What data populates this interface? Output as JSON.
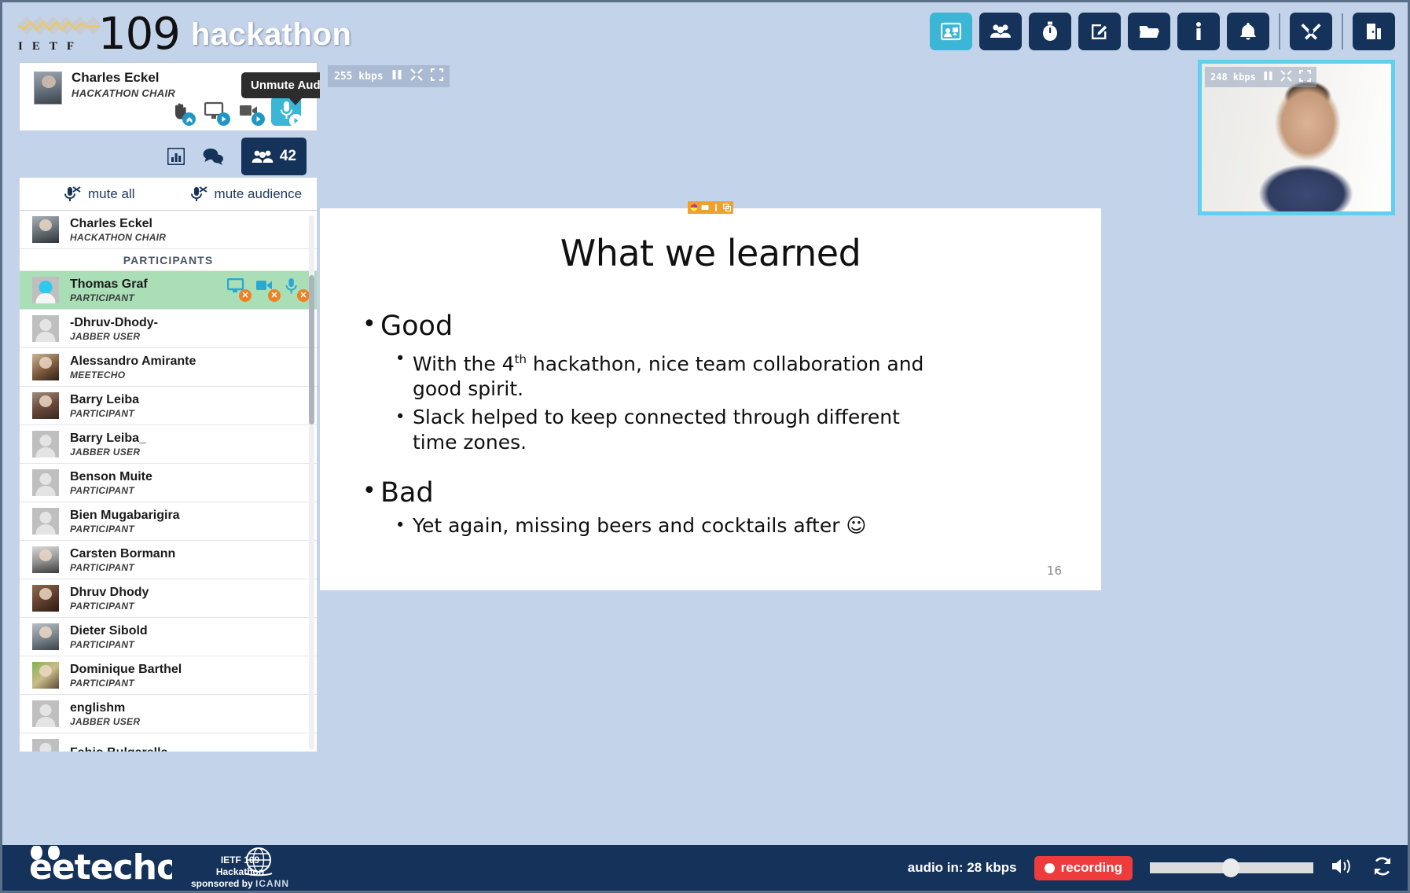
{
  "header": {
    "conference_number": "109",
    "conference_word": "hackathon",
    "ietf_letters": "IETF",
    "toolbar": [
      {
        "name": "presentation-icon",
        "label": "Presentation",
        "active": true
      },
      {
        "name": "participants-icon",
        "label": "Participants",
        "active": false
      },
      {
        "name": "timer-icon",
        "label": "Timer",
        "active": false
      },
      {
        "name": "notes-icon",
        "label": "Notes",
        "active": false
      },
      {
        "name": "folder-icon",
        "label": "Materials",
        "active": false
      },
      {
        "name": "info-icon",
        "label": "Info",
        "active": false
      },
      {
        "name": "bell-icon",
        "label": "Notifications",
        "active": false
      },
      {
        "name": "tools-icon",
        "label": "Tools",
        "active": false
      },
      {
        "name": "exit-icon",
        "label": "Exit",
        "active": false
      }
    ]
  },
  "presenter": {
    "name": "Charles Eckel",
    "role": "HACKATHON CHAIR",
    "tooltip": "Unmute Audio",
    "actions": [
      {
        "name": "raise-hand-button",
        "label": "Raise Hand"
      },
      {
        "name": "share-screen-button",
        "label": "Share Screen"
      },
      {
        "name": "share-video-button",
        "label": "Share Video"
      },
      {
        "name": "unmute-audio-button",
        "label": "Unmute Audio",
        "active": true
      }
    ]
  },
  "tabs": {
    "stats_label": "Statistics",
    "chat_label": "Chat",
    "participants_label": "Participants",
    "participants_count": "42"
  },
  "mute_controls": {
    "mute_all": "mute all",
    "mute_audience": "mute audience"
  },
  "participant_list": {
    "section_header": "PARTICIPANTS",
    "chair": {
      "name": "Charles Eckel",
      "role": "HACKATHON CHAIR"
    },
    "items": [
      {
        "name": "Thomas Graf",
        "role": "PARTICIPANT",
        "highlighted": true,
        "icons": [
          "screen-off-icon",
          "camera-off-icon",
          "mic-off-icon"
        ]
      },
      {
        "name": "-Dhruv-Dhody-",
        "role": "JABBER USER"
      },
      {
        "name": "Alessandro Amirante",
        "role": "MEETECHO"
      },
      {
        "name": "Barry Leiba",
        "role": "PARTICIPANT"
      },
      {
        "name": "Barry Leiba_",
        "role": "JABBER USER"
      },
      {
        "name": "Benson Muite",
        "role": "PARTICIPANT"
      },
      {
        "name": "Bien Mugabarigira",
        "role": "PARTICIPANT"
      },
      {
        "name": "Carsten Bormann",
        "role": "PARTICIPANT"
      },
      {
        "name": "Dhruv Dhody",
        "role": "PARTICIPANT"
      },
      {
        "name": "Dieter Sibold",
        "role": "PARTICIPANT"
      },
      {
        "name": "Dominique Barthel",
        "role": "PARTICIPANT"
      },
      {
        "name": "englishm",
        "role": "JABBER USER"
      },
      {
        "name": "Fabio Bulgarella",
        "role": ""
      }
    ]
  },
  "stream_main": {
    "bitrate": "255  kbps",
    "pause_label": "Pause",
    "resize_label": "Resize",
    "fullscreen_label": "Fullscreen"
  },
  "webcam": {
    "bitrate": "248  kbps",
    "pause_label": "Pause",
    "resize_label": "Resize",
    "fullscreen_label": "Fullscreen"
  },
  "slide": {
    "title": "What we learned",
    "page_number": "16",
    "blocks": [
      {
        "level": 1,
        "text": "Good"
      },
      {
        "level": 2,
        "text_before": "With the 4",
        "sup": "th",
        "text_after": " hackathon, nice team collaboration and good spirit."
      },
      {
        "level": 2,
        "text": "Slack helped to keep connected through different time zones."
      },
      {
        "level": 1,
        "text": "Bad"
      },
      {
        "level": 2,
        "text": "Yet again, missing beers and cocktails after ☺"
      }
    ]
  },
  "footer": {
    "brand": "eetecho",
    "sponsor_line1": "IETF 109",
    "sponsor_line2": "Hackathon",
    "sponsor_line3": "sponsored by",
    "sponsor_name": "ICANN",
    "audio_in": "audio in: 28 kbps",
    "recording": "recording",
    "volume_label": "Volume",
    "refresh_label": "Refresh"
  },
  "colors": {
    "accent": "#3bb6d6",
    "navy": "#15325a",
    "page_bg": "#c3d3ea",
    "highlight_row": "#aadeb7",
    "recording_red": "#ee3b3b",
    "badge_orange": "#f08024"
  }
}
